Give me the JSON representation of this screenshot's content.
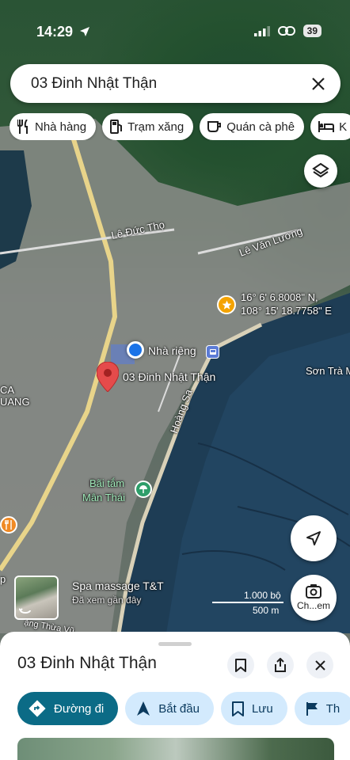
{
  "status": {
    "time": "14:29",
    "battery": "39"
  },
  "search": {
    "query": "03 Đinh Nhật Thận"
  },
  "chips": [
    {
      "label": "Nhà hàng",
      "icon": "restaurant-icon"
    },
    {
      "label": "Trạm xăng",
      "icon": "gas-station-icon"
    },
    {
      "label": "Quán cà phê",
      "icon": "coffee-icon"
    },
    {
      "label": "K",
      "icon": "hotel-icon"
    }
  ],
  "map": {
    "labels": {
      "le_duc_tho": "Lê Đức Thọ",
      "le_van_luong": "Lê Văn Lương",
      "son_tra": "Sơn Trà M",
      "hoang_sa": "Hoàng Sa",
      "ca": "CA",
      "uang": "UANG",
      "bai_tam": "Bãi tắm",
      "man_thai": "Mân Thái",
      "dang_thua": "ặng Thừa Vũ",
      "p": "p"
    },
    "coordinates": {
      "lat": "16° 6' 6.8008\" N,",
      "lng": "108° 15' 18.7758\" E"
    },
    "home_label": "Nhà riêng",
    "pin_label": "03 Đinh Nhật Thận",
    "spa": {
      "name": "Spa massage T&T",
      "status": "Đã xem gần đây"
    },
    "scale": {
      "imperial": "1.000 bộ",
      "metric": "500 m"
    },
    "share_label": "Ch...em"
  },
  "sheet": {
    "title": "03 Đinh Nhật Thận",
    "actions": [
      {
        "label": "Đường đi",
        "icon": "directions-icon"
      },
      {
        "label": "Bắt đầu",
        "icon": "navigation-arrow-icon"
      },
      {
        "label": "Lưu",
        "icon": "bookmark-icon"
      },
      {
        "label": "Th",
        "icon": "flag-icon"
      }
    ]
  },
  "colors": {
    "primary": "#0b6b86",
    "tonal": "#d3eafd",
    "pin": "#e54b4b",
    "home": "#1a73e8",
    "star": "#f4a300"
  }
}
